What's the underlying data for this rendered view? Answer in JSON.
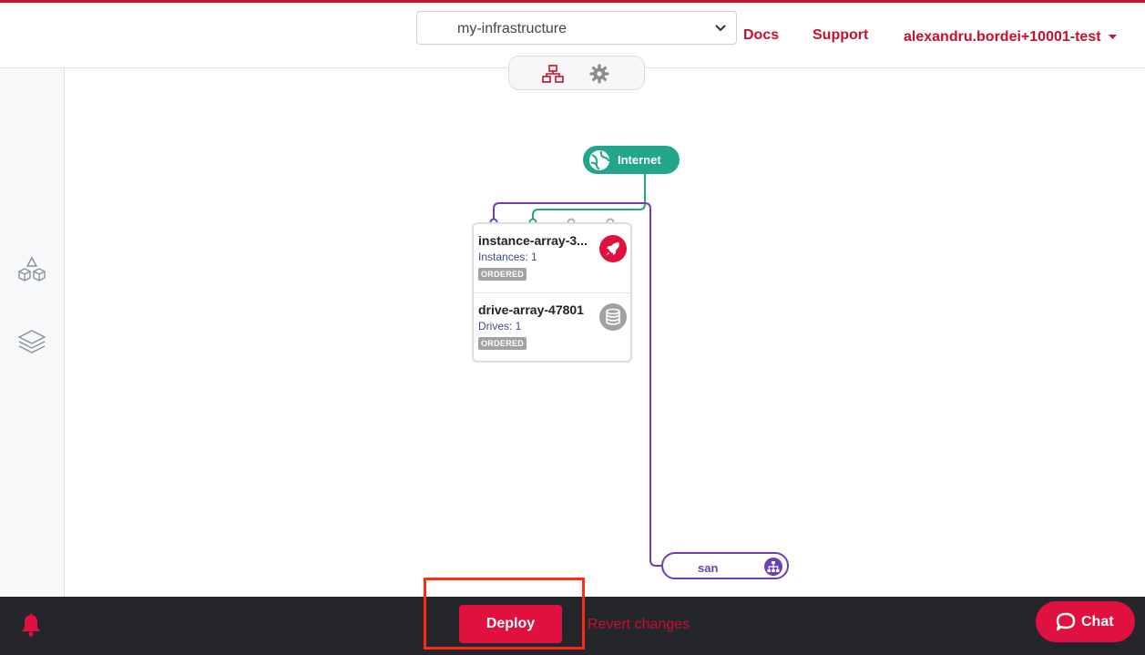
{
  "header": {
    "infrastructure_select": {
      "value": "my-infrastructure"
    },
    "links": {
      "docs": "Docs",
      "support": "Support"
    },
    "user": {
      "name": "alexandru.bordei+10001-test"
    }
  },
  "view_toggle": {
    "items": [
      "topology-icon",
      "gear-icon"
    ],
    "active": "topology-icon"
  },
  "sidebar": {
    "items": [
      "cubes-icon",
      "layers-icon"
    ]
  },
  "canvas": {
    "internet_node": {
      "label": "Internet"
    },
    "instance_array": {
      "title": "instance-array-3...",
      "instances": "Instances: 1",
      "status": "ORDERED",
      "icon": "rocket-icon"
    },
    "drive_array": {
      "title": "drive-array-47801",
      "drives": "Drives: 1",
      "status": "ORDERED",
      "icon": "database-icon"
    },
    "san_node": {
      "label": "san",
      "icon": "network-icon"
    }
  },
  "bottom_bar": {
    "deploy_label": "Deploy",
    "revert_label": "Revert changes",
    "chat_label": "Chat"
  },
  "colors": {
    "brand_red": "#c8102e",
    "deploy_red": "#e0103f",
    "internet_green": "#22a68a",
    "san_purple": "#6a3fb8",
    "bottom_bar": "#24262b",
    "highlight": "#ff2a12"
  }
}
